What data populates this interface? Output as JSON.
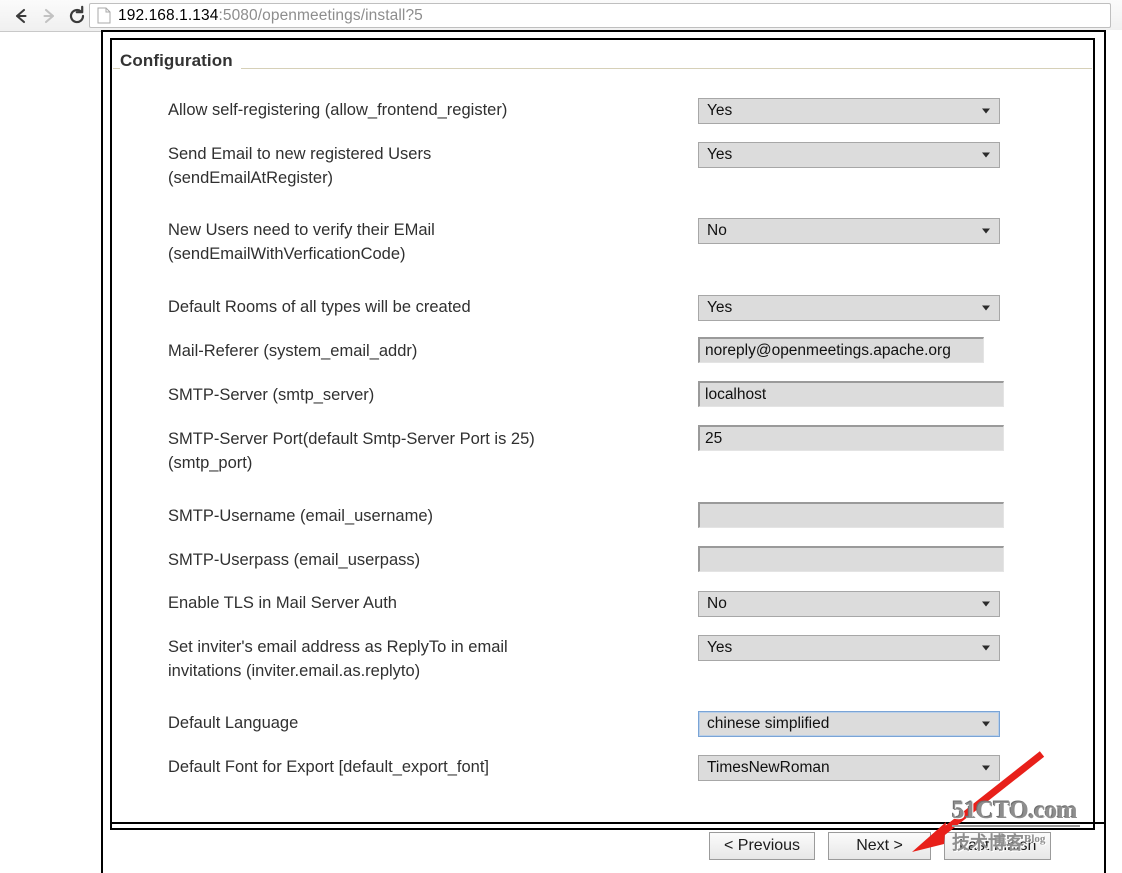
{
  "browser": {
    "back_icon": "back-arrow-icon",
    "forward_icon": "forward-arrow-icon",
    "reload_icon": "reload-icon",
    "page_icon": "page-document-icon",
    "url_host": "192.168.1.134",
    "url_path": ":5080/openmeetings/install?5",
    "url_full": "192.168.1.134:5080/openmeetings/install?5"
  },
  "page": {
    "legend": "Configuration",
    "legend_rule_color": "#d6d0b8"
  },
  "form": {
    "rows": [
      {
        "label": "Allow self-registering (allow_frontend_register)",
        "control": "select",
        "value": "Yes",
        "name": "allow-frontend-register"
      },
      {
        "label": "Send Email to new registered Users\n(sendEmailAtRegister)",
        "control": "select",
        "value": "Yes",
        "name": "send-email-at-register"
      },
      {
        "label": "New Users need to verify their EMail\n(sendEmailWithVerficationCode)",
        "control": "select",
        "value": "No",
        "name": "send-email-with-verfication-code"
      },
      {
        "label": "Default Rooms of all types will be created",
        "control": "select",
        "value": "Yes",
        "name": "default-rooms-created"
      },
      {
        "label": "Mail-Referer (system_email_addr)",
        "control": "text",
        "value": "noreply@openmeetings.apache.org",
        "name": "system-email-addr"
      },
      {
        "label": "SMTP-Server (smtp_server)",
        "control": "text",
        "value": "localhost",
        "name": "smtp-server"
      },
      {
        "label": "SMTP-Server Port(default Smtp-Server Port is 25)\n(smtp_port)",
        "control": "text",
        "value": "25",
        "name": "smtp-port"
      },
      {
        "label": "SMTP-Username (email_username)",
        "control": "text",
        "value": "",
        "name": "email-username"
      },
      {
        "label": "SMTP-Userpass (email_userpass)",
        "control": "text",
        "value": "",
        "name": "email-userpass"
      },
      {
        "label": "Enable TLS in Mail Server Auth",
        "control": "select",
        "value": "No",
        "name": "enable-tls"
      },
      {
        "label": "Set inviter's email address as ReplyTo in email\ninvitations (inviter.email.as.replyto)",
        "control": "select",
        "value": "Yes",
        "name": "inviter-email-as-replyto"
      },
      {
        "label": "Default Language",
        "control": "select",
        "value": "chinese simplified",
        "name": "default-language",
        "focused": true
      },
      {
        "label": "Default Font for Export [default_export_font]",
        "control": "select",
        "value": "TimesNewRoman",
        "name": "default-export-font"
      }
    ]
  },
  "footer": {
    "previous_label": "< Previous",
    "next_label": "Next >",
    "last_label": "Last Finish"
  },
  "annotation": {
    "arrow_color": "#e8201a",
    "points_to": "Next >"
  },
  "watermark": {
    "top": "51CTO.com",
    "bottom": "技术博客",
    "superscript": "Blog"
  }
}
